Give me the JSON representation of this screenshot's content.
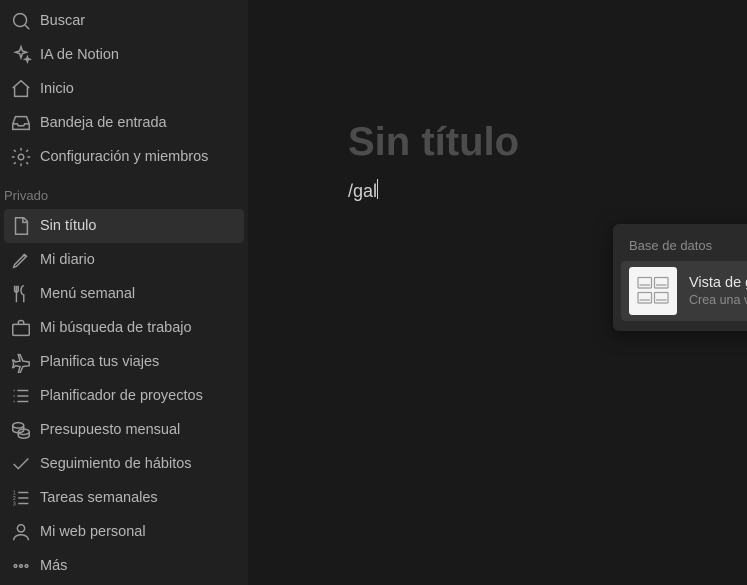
{
  "sidebar": {
    "top": {
      "search": {
        "label": "Buscar"
      },
      "ai": {
        "label": "IA de Notion"
      },
      "home": {
        "label": "Inicio"
      },
      "inbox": {
        "label": "Bandeja de entrada"
      },
      "settings": {
        "label": "Configuración y miembros"
      }
    },
    "section_label": "Privado",
    "pages": {
      "untitled": {
        "label": "Sin título"
      },
      "diary": {
        "label": "Mi diario"
      },
      "menu": {
        "label": "Menú semanal"
      },
      "jobs": {
        "label": "Mi búsqueda de trabajo"
      },
      "travel": {
        "label": "Planifica tus viajes"
      },
      "projects": {
        "label": "Planificador de proyectos"
      },
      "budget": {
        "label": "Presupuesto mensual"
      },
      "habits": {
        "label": "Seguimiento de hábitos"
      },
      "tasks": {
        "label": "Tareas semanales"
      },
      "web": {
        "label": "Mi web personal"
      },
      "more": {
        "label": "Más"
      }
    }
  },
  "main": {
    "title_placeholder": "Sin título",
    "slash_text": "/gal"
  },
  "popup": {
    "section": "Base de datos",
    "item": {
      "title": "Vista de galería",
      "desc": "Crea una vista de galería de la base de dat..."
    }
  }
}
